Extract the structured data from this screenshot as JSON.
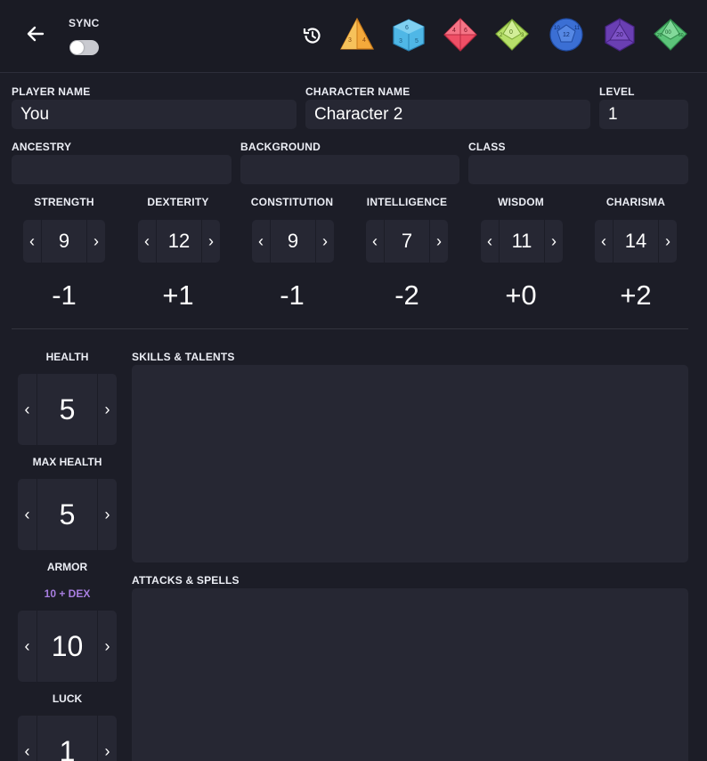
{
  "header": {
    "sync_label": "SYNC",
    "sync_enabled": false,
    "dice": [
      {
        "icon": "d4-die-icon",
        "color": "#f4a93b"
      },
      {
        "icon": "d6-die-icon",
        "color": "#4fb7e6"
      },
      {
        "icon": "d8-die-icon",
        "color": "#ef4f66"
      },
      {
        "icon": "d10-die-icon",
        "color": "#b7e06a"
      },
      {
        "icon": "d12-die-icon",
        "color": "#3b6fd4"
      },
      {
        "icon": "d20-die-icon",
        "color": "#6a3fb3"
      },
      {
        "icon": "d100-die-icon",
        "color": "#5cc47a"
      }
    ]
  },
  "identity": {
    "player_name_label": "PLAYER NAME",
    "player_name_value": "You",
    "character_name_label": "CHARACTER NAME",
    "character_name_value": "Character 2",
    "level_label": "LEVEL",
    "level_value": "1",
    "ancestry_label": "ANCESTRY",
    "ancestry_value": "",
    "background_label": "BACKGROUND",
    "background_value": "",
    "class_label": "CLASS",
    "class_value": ""
  },
  "stats": [
    {
      "label": "STRENGTH",
      "value": "9",
      "modifier": "-1"
    },
    {
      "label": "DEXTERITY",
      "value": "12",
      "modifier": "+1"
    },
    {
      "label": "CONSTITUTION",
      "value": "9",
      "modifier": "-1"
    },
    {
      "label": "INTELLIGENCE",
      "value": "7",
      "modifier": "-2"
    },
    {
      "label": "WISDOM",
      "value": "11",
      "modifier": "+0"
    },
    {
      "label": "CHARISMA",
      "value": "14",
      "modifier": "+2"
    }
  ],
  "vitals": {
    "health_label": "HEALTH",
    "health_value": "5",
    "max_health_label": "MAX HEALTH",
    "max_health_value": "5",
    "armor_label": "ARMOR",
    "armor_formula": "10 + DEX",
    "armor_value": "10",
    "luck_label": "LUCK",
    "luck_value": "1"
  },
  "notes": {
    "skills_label": "SKILLS & TALENTS",
    "skills_value": "",
    "attacks_label": "ATTACKS & SPELLS",
    "attacks_value": ""
  },
  "arrows": {
    "left": "‹",
    "right": "›"
  }
}
